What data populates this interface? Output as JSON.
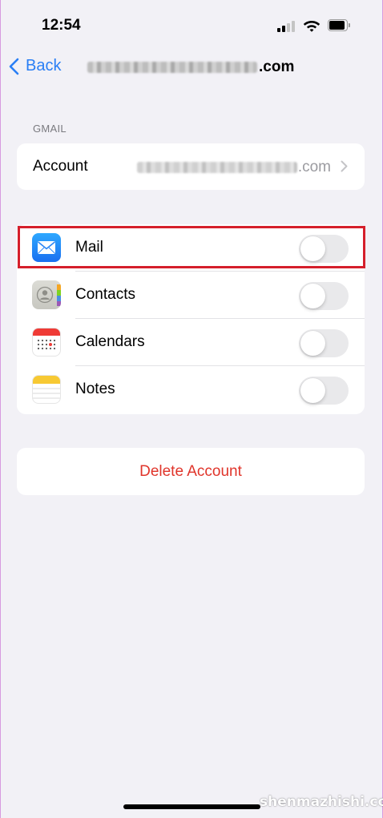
{
  "status_bar": {
    "time": "12:54"
  },
  "nav": {
    "back_label": "Back",
    "title_suffix": ".com"
  },
  "section": {
    "header": "GMAIL"
  },
  "account": {
    "label": "Account",
    "value_suffix": ".com"
  },
  "services": [
    {
      "label": "Mail",
      "icon": "mail-icon",
      "enabled": false
    },
    {
      "label": "Contacts",
      "icon": "contacts-icon",
      "enabled": false
    },
    {
      "label": "Calendars",
      "icon": "calendar-icon",
      "enabled": false
    },
    {
      "label": "Notes",
      "icon": "notes-icon",
      "enabled": false
    }
  ],
  "delete_account_label": "Delete Account",
  "watermark": "shenmazhishi.com",
  "colors": {
    "background": "#f2f1f6",
    "accent": "#2a7ff5",
    "destructive": "#e0352b",
    "highlight": "#d51f2b",
    "toggle_off": "#e9e9eb"
  }
}
